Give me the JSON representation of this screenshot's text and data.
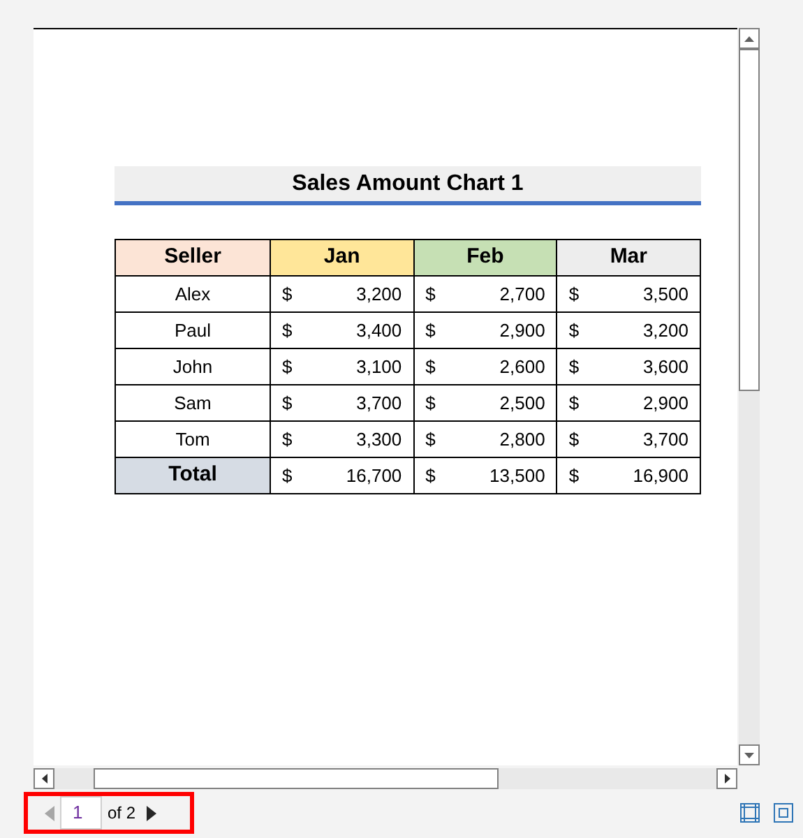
{
  "title": "Sales Amount Chart 1",
  "columns": [
    {
      "label": "Seller",
      "color": "#fce4d6"
    },
    {
      "label": "Jan",
      "color": "#ffe699"
    },
    {
      "label": "Feb",
      "color": "#c6e0b4"
    },
    {
      "label": "Mar",
      "color": "#ededed"
    }
  ],
  "rows": [
    {
      "seller": "Alex",
      "values": [
        [
          "$",
          "3,200"
        ],
        [
          "$",
          "2,700"
        ],
        [
          "$",
          "3,500"
        ]
      ]
    },
    {
      "seller": "Paul",
      "values": [
        [
          "$",
          "3,400"
        ],
        [
          "$",
          "2,900"
        ],
        [
          "$",
          "3,200"
        ]
      ]
    },
    {
      "seller": "John",
      "values": [
        [
          "$",
          "3,100"
        ],
        [
          "$",
          "2,600"
        ],
        [
          "$",
          "3,600"
        ]
      ]
    },
    {
      "seller": "Sam",
      "values": [
        [
          "$",
          "3,700"
        ],
        [
          "$",
          "2,500"
        ],
        [
          "$",
          "2,900"
        ]
      ]
    },
    {
      "seller": "Tom",
      "values": [
        [
          "$",
          "3,300"
        ],
        [
          "$",
          "2,800"
        ],
        [
          "$",
          "3,700"
        ]
      ]
    }
  ],
  "total": {
    "label": "Total",
    "values": [
      [
        "$",
        "16,700"
      ],
      [
        "$",
        "13,500"
      ],
      [
        "$",
        "16,900"
      ]
    ]
  },
  "page_nav": {
    "page": "1",
    "of": "of 2",
    "prev_disabled": true,
    "next_disabled": false,
    "highlighted": true
  }
}
